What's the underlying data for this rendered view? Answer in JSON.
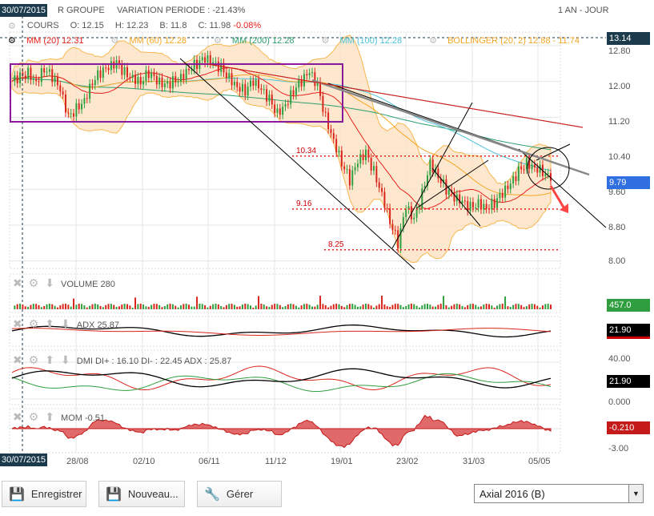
{
  "header": {
    "date_badge": "30/07/2015",
    "title": "R GROUPE",
    "variation": "VARIATION PERIODE : -21.43%",
    "period": "1 AN - JOUR"
  },
  "quote": {
    "label": "COURS",
    "open": "O: 12.15",
    "high": "H: 12.23",
    "low": "B: 11.8",
    "close": "C: 11.98",
    "change": "-0.08%"
  },
  "indicators": [
    {
      "label": "MM (20) 12.31",
      "color": "#e8201c"
    },
    {
      "label": "MM (60) 12.28",
      "color": "#f5a623"
    },
    {
      "label": "MM (200) 12.28",
      "color": "#2e9e6e"
    },
    {
      "label": "MM (100) 12.28",
      "color": "#4cc3d9"
    },
    {
      "label": "BOLLINGER (20, 2) 12.88 - 11.74",
      "color": "#f5a623"
    }
  ],
  "panels": {
    "volume": "VOLUME  280",
    "adx": "ADX  25.87",
    "dmi": "DMI  DI+ : 16.10  DI- : 22.45  ADX : 25.87",
    "mom": "MOM  -0.51"
  },
  "badges": {
    "top": "13.14",
    "price": "9.79",
    "volume": "457.0",
    "adx": "21.90",
    "dmi": "21.90",
    "mom": "-0.210"
  },
  "axis_extra": {
    "adx_zero": "0.000",
    "dmi_40": "40.00",
    "dmi_zero": "0.000",
    "mom_min": "-3.00"
  },
  "levels": [
    {
      "label": "10.34",
      "value": 10.34
    },
    {
      "label": "9.16",
      "value": 9.16
    },
    {
      "label": "8.25",
      "value": 8.25
    }
  ],
  "toolbar": {
    "save": "Enregistrer",
    "new": "Nouveau...",
    "manage": "Gérer",
    "layout": "Axial 2016 (B)"
  },
  "chart_data": {
    "type": "candlestick",
    "y_ticks": [
      "12.80",
      "12.00",
      "11.20",
      "10.40",
      "9.60",
      "8.80",
      "8.00"
    ],
    "ylim": [
      7.9,
      13.2
    ],
    "x_labels": [
      "30/07/2015",
      "28/08",
      "02/10",
      "06/11",
      "11/12",
      "19/01",
      "23/02",
      "31/03",
      "05/05"
    ],
    "close": [
      12.0,
      12.1,
      12.2,
      12.0,
      12.3,
      12.1,
      11.8,
      11.2,
      11.4,
      11.6,
      12.0,
      12.2,
      12.3,
      12.4,
      12.2,
      12.1,
      12.0,
      12.2,
      12.0,
      11.9,
      12.0,
      12.1,
      12.3,
      12.4,
      12.5,
      12.4,
      12.3,
      12.1,
      11.9,
      11.8,
      12.0,
      11.8,
      11.6,
      11.3,
      11.5,
      11.8,
      12.0,
      12.2,
      11.9,
      11.2,
      10.7,
      10.2,
      9.8,
      10.2,
      10.4,
      10.0,
      9.5,
      8.9,
      8.4,
      9.2,
      8.9,
      9.5,
      10.2,
      9.9,
      9.6,
      9.4,
      9.3,
      9.2,
      9.3,
      9.2,
      9.3,
      9.5,
      9.7,
      10.0,
      10.2,
      10.1,
      10.0,
      9.79
    ]
  }
}
